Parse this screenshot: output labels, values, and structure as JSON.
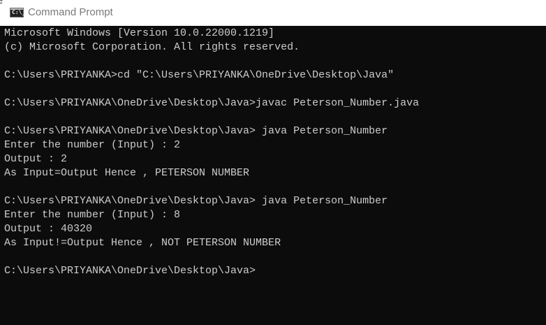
{
  "window": {
    "title": "Command Prompt",
    "edge_glyph": "e"
  },
  "app_icon": {
    "name": "command-prompt-icon",
    "text": "C:\\_"
  },
  "console": {
    "lines": [
      "Microsoft Windows [Version 10.0.22000.1219]",
      "(c) Microsoft Corporation. All rights reserved.",
      "",
      "C:\\Users\\PRIYANKA>cd \"C:\\Users\\PRIYANKA\\OneDrive\\Desktop\\Java\"",
      "",
      "C:\\Users\\PRIYANKA\\OneDrive\\Desktop\\Java>javac Peterson_Number.java",
      "",
      "C:\\Users\\PRIYANKA\\OneDrive\\Desktop\\Java> java Peterson_Number",
      "Enter the number (Input) : 2",
      "Output : 2",
      "As Input=Output Hence , PETERSON NUMBER",
      "",
      "C:\\Users\\PRIYANKA\\OneDrive\\Desktop\\Java> java Peterson_Number",
      "Enter the number (Input) : 8",
      "Output : 40320",
      "As Input!=Output Hence , NOT PETERSON NUMBER",
      "",
      "C:\\Users\\PRIYANKA\\OneDrive\\Desktop\\Java>"
    ]
  },
  "colors": {
    "console_background": "#0c0c0c",
    "console_text": "#cccccc",
    "titlebar_background": "#ffffff",
    "title_text": "#7a7a7a"
  }
}
